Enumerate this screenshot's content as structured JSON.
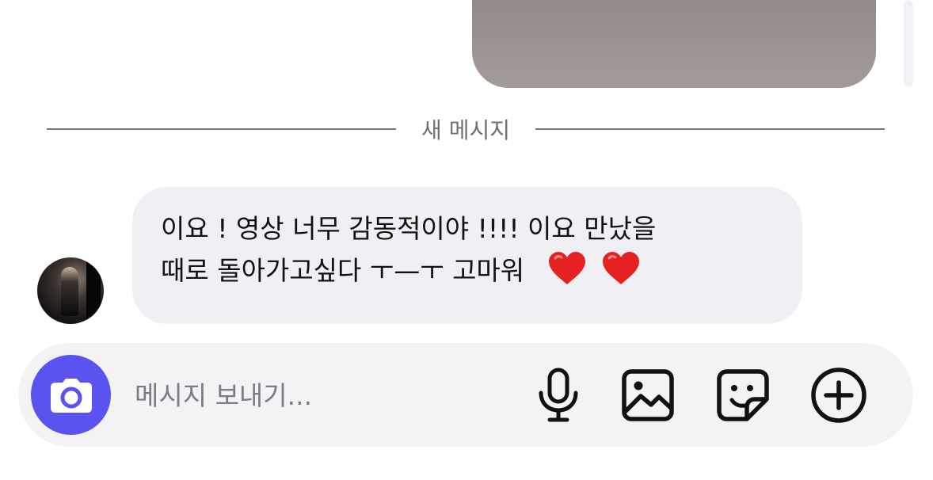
{
  "conversation": {
    "new_messages_divider_label": "새 메시지",
    "incoming_message": {
      "line1": "이요 ! 영상 너무 감동적이야 !!!! 이요 만났을",
      "line2": "때로 돌아가고싶다 ㅜ—ㅜ 고마워",
      "emoji": [
        "❤️",
        "❤️"
      ]
    }
  },
  "composer": {
    "placeholder": "메시지 보내기...",
    "icons": [
      "camera-icon",
      "microphone-icon",
      "gallery-icon",
      "sticker-icon",
      "plus-icon"
    ]
  },
  "colors": {
    "accent": "#5b53f0",
    "bubble_background": "#efeff4",
    "composer_background": "#f3f3f6",
    "divider": "#76767b",
    "heart": "#e62121"
  }
}
